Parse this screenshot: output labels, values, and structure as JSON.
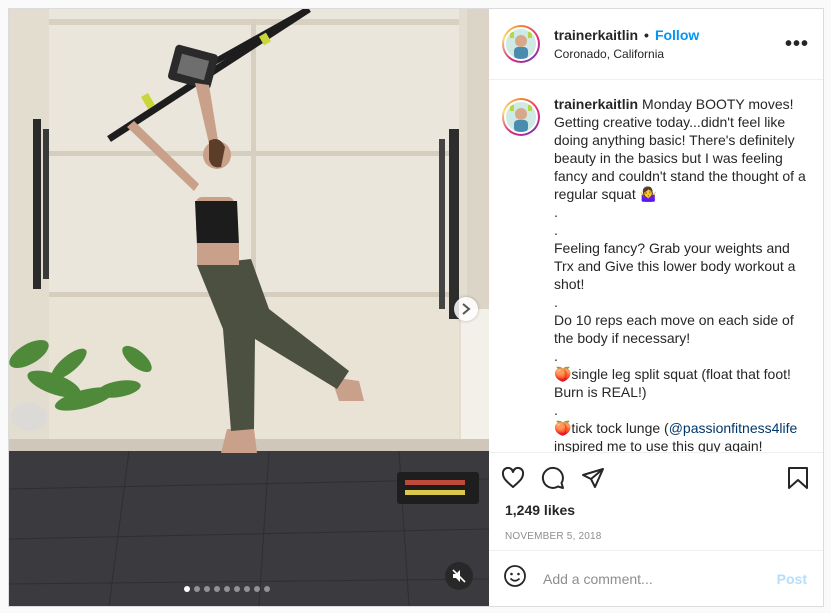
{
  "post": {
    "username": "trainerkaitlin",
    "follow_label": "Follow",
    "separator": "•",
    "location": "Coronado, California",
    "more_label": "•••",
    "caption": "Monday BOOTY moves! Getting creative today...didn't feel like doing anything basic! There's definitely beauty in the basics but I was feeling fancy and couldn't stand the thought of a regular squat 🤷‍♀️\n.\n.\nFeeling fancy? Grab your weights and Trx and Give this lower body workout a shot!\n.\nDo 10 reps each move on each side of the body if necessary!\n.\n🍑single leg split squat (float that foot! Burn is REAL!)\n.\n🍑tick tock lunge (",
    "mention": "@passionfitness4life",
    "caption_tail": " inspired me to use this guy again!",
    "likes": "1,249 likes",
    "date": "NOVEMBER 5, 2018",
    "comment_placeholder": "Add a comment...",
    "post_label": "Post"
  },
  "carousel": {
    "slide_count": 9,
    "active_index": 0
  },
  "icons": {
    "like": "heart-icon",
    "comment": "comment-icon",
    "share": "share-icon",
    "save": "bookmark-icon",
    "emoji": "emoji-icon",
    "mute": "mute-icon",
    "next": "chevron-right-icon"
  },
  "colors": {
    "follow": "#0095f6",
    "post_disabled": "#b2dffc",
    "mention": "#00376b"
  }
}
